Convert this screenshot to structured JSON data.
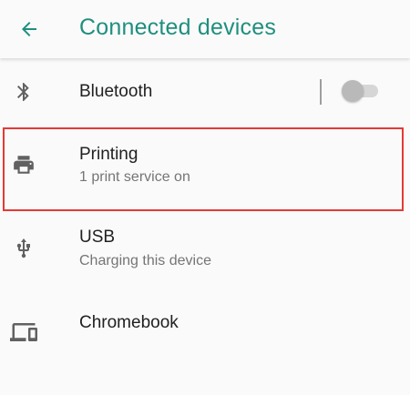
{
  "app_bar": {
    "title": "Connected devices",
    "back_icon": "arrow-left-icon",
    "accent_color": "#1f8f7e"
  },
  "items": [
    {
      "icon": "bluetooth-icon",
      "title": "Bluetooth",
      "summary": "",
      "toggle_on": false
    },
    {
      "icon": "printer-icon",
      "title": "Printing",
      "summary": "1 print service on"
    },
    {
      "icon": "usb-icon",
      "title": "USB",
      "summary": "Charging this device"
    },
    {
      "icon": "devices-icon",
      "title": "Chromebook",
      "summary": ""
    }
  ],
  "highlight_color": "#e53935"
}
